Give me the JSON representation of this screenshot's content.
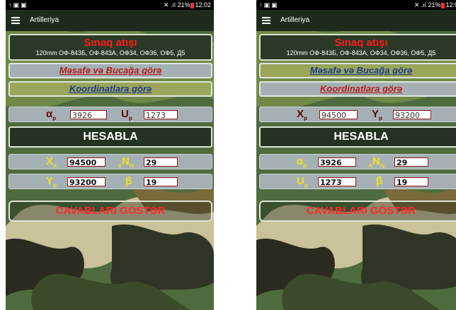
{
  "status": {
    "left_icons": "↑▣▣",
    "signal": "✕ .ıl",
    "battery_percent": "21%",
    "time": "12:02"
  },
  "app": {
    "title": "Artilleriya"
  },
  "header": {
    "title": "Sınaq atışı",
    "subtitle": "120mm ОФ-843Б, ОФ-843А, ОФ34, ОФ36, ОФ5, Д5"
  },
  "nav": {
    "tab1": "Məsafə və Bucağa görə",
    "tab2": "Koordinatlara görə"
  },
  "left": {
    "alpha": {
      "symbol": "α",
      "sub": "p",
      "value": "3926"
    },
    "u": {
      "symbol": "U",
      "sub": "p",
      "value": "1273"
    },
    "x": {
      "symbol": "X",
      "sub": "p",
      "value": "94500"
    },
    "dn": {
      "prefix": "∆",
      "symbol": "N",
      "sub": "iş",
      "value": "29"
    },
    "y": {
      "symbol": "Y",
      "sub": "p",
      "value": "93200"
    },
    "beta": {
      "symbol": "β",
      "value": "19"
    }
  },
  "right": {
    "x": {
      "symbol": "X",
      "sub": "p",
      "value": "94500"
    },
    "y": {
      "symbol": "Y",
      "sub": "p",
      "value": "93200"
    },
    "alpha": {
      "symbol": "α",
      "sub": "p",
      "value": "3926"
    },
    "dn": {
      "prefix": "∆",
      "symbol": "N",
      "sub": "iş",
      "value": "29"
    },
    "u": {
      "symbol": "U",
      "sub": "p",
      "value": "1273"
    },
    "beta": {
      "symbol": "β",
      "value": "19"
    }
  },
  "buttons": {
    "calculate": "HESABLA",
    "show_answers": "CAVABLARI GÖSTƏR"
  },
  "colors": {
    "title_red": "#ff1a1a",
    "active_tab": "#9aa65a",
    "inactive_tab": "#a5b0b5",
    "label_yellow": "#f2e21d",
    "label_dark": "#5c0a0a"
  }
}
